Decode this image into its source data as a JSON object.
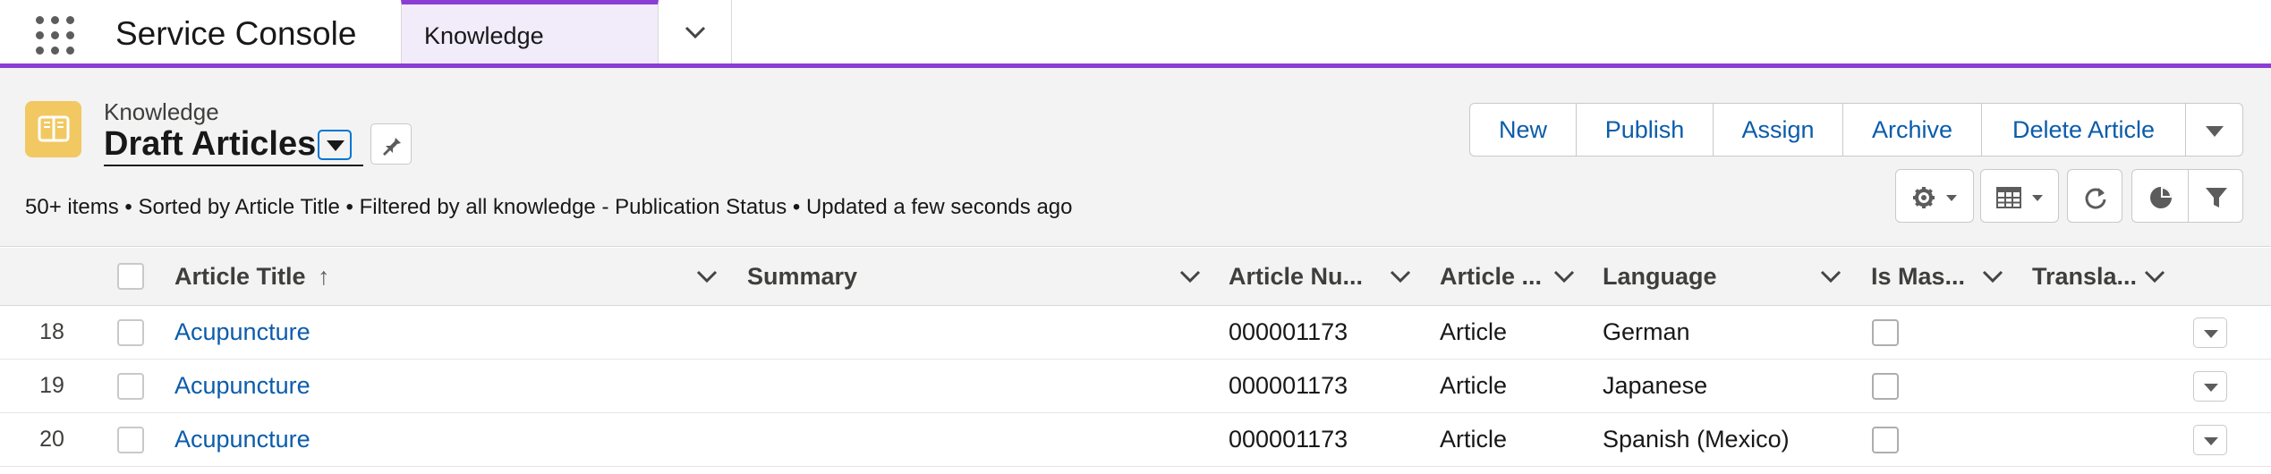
{
  "app": {
    "title": "Service Console",
    "tab_label": "Knowledge",
    "accent_color": "#8a3ed4"
  },
  "header": {
    "object_name": "Knowledge",
    "view_name": "Draft Articles",
    "icon": "knowledge-book-icon",
    "info": "50+ items • Sorted by Article Title • Filtered by all knowledge - Publication Status • Updated a few seconds ago",
    "actions": [
      "New",
      "Publish",
      "Assign",
      "Archive",
      "Delete Article"
    ]
  },
  "table": {
    "columns": [
      "Article Title",
      "Summary",
      "Article Nu...",
      "Article ...",
      "Language",
      "Is Mas...",
      "Transla..."
    ],
    "sort_indicator": "↑",
    "rows": [
      {
        "num": "18",
        "title": "Acupuncture",
        "summary": "",
        "article_number": "000001173",
        "type": "Article",
        "language": "German",
        "is_master": false,
        "translation": ""
      },
      {
        "num": "19",
        "title": "Acupuncture",
        "summary": "",
        "article_number": "000001173",
        "type": "Article",
        "language": "Japanese",
        "is_master": false,
        "translation": ""
      },
      {
        "num": "20",
        "title": "Acupuncture",
        "summary": "",
        "article_number": "000001173",
        "type": "Article",
        "language": "Spanish (Mexico)",
        "is_master": false,
        "translation": ""
      }
    ]
  }
}
